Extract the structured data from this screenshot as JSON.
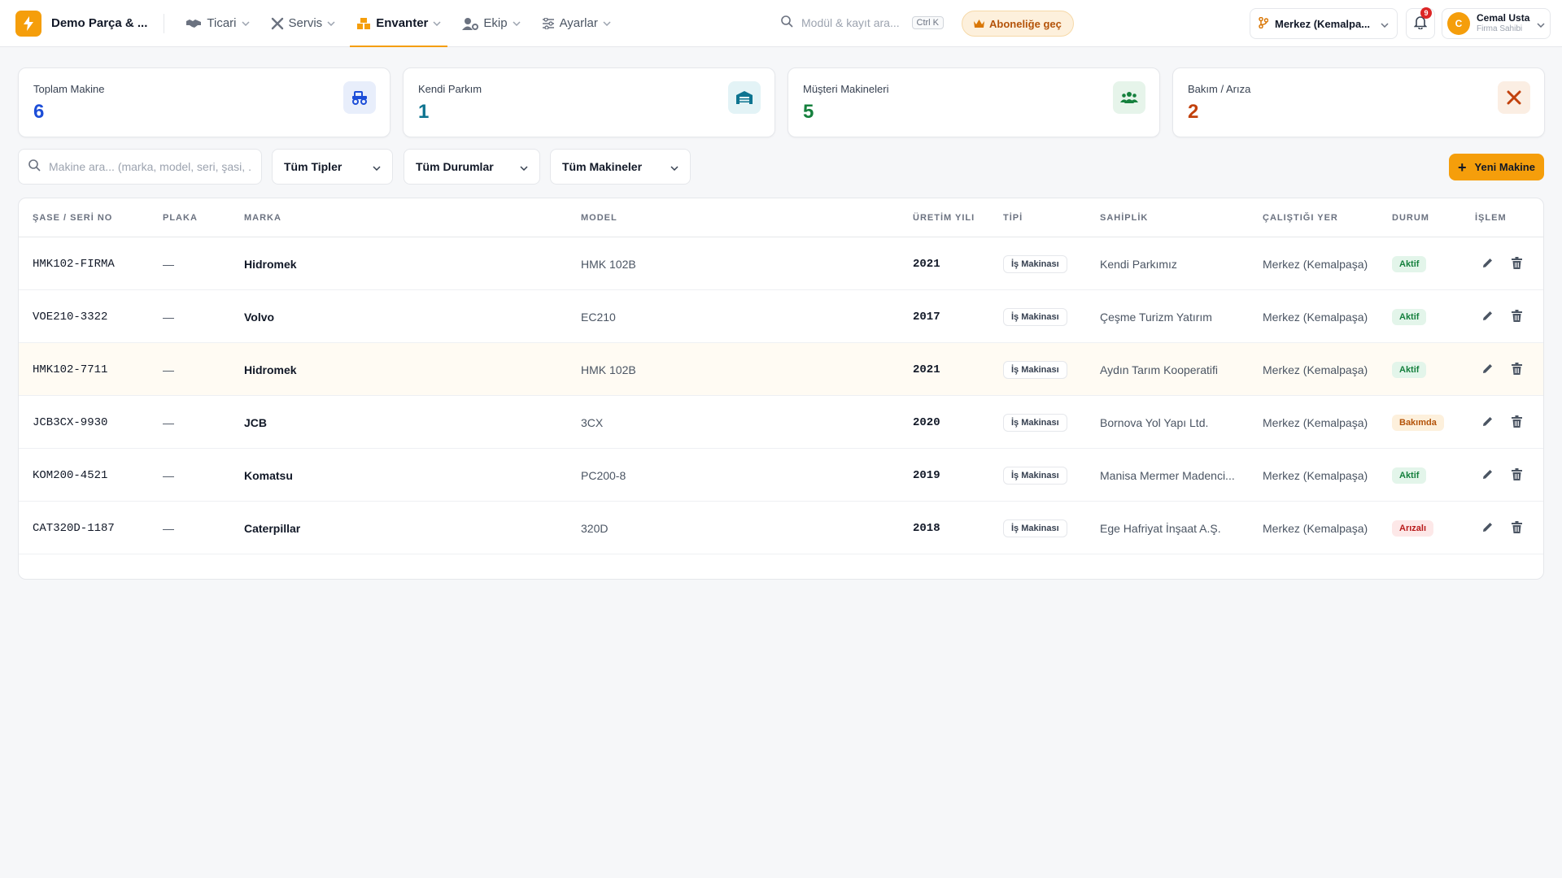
{
  "header": {
    "brand_name": "Demo Parça & ...",
    "nav": [
      {
        "label": "Ticari",
        "icon": "handshake-icon"
      },
      {
        "label": "Servis",
        "icon": "tools-icon"
      },
      {
        "label": "Envanter",
        "icon": "boxes-icon",
        "active": true
      },
      {
        "label": "Ekip",
        "icon": "user-gear-icon"
      },
      {
        "label": "Ayarlar",
        "icon": "sliders-icon"
      }
    ],
    "search_placeholder": "Modül & kayıt ara...",
    "search_shortcut": "Ctrl K",
    "upgrade_label": "Aboneliğe geç",
    "branch_label": "Merkez (Kemalpa...",
    "notification_count": "9",
    "user": {
      "initial": "C",
      "name": "Cemal Usta",
      "role": "Firma Sahibi"
    }
  },
  "stats": [
    {
      "label": "Toplam Makine",
      "value": "6",
      "color": "#1d4ed8",
      "icon": "tractor-icon",
      "icon_bg": "#e8eefb"
    },
    {
      "label": "Kendi Parkım",
      "value": "1",
      "color": "#0e7490",
      "icon": "warehouse-icon",
      "icon_bg": "#e3f3f6"
    },
    {
      "label": "Müşteri Makineleri",
      "value": "5",
      "color": "#15803d",
      "icon": "users-icon",
      "icon_bg": "#e6f4ea"
    },
    {
      "label": "Bakım / Arıza",
      "value": "2",
      "color": "#c2410c",
      "icon": "wrench-screwdriver-icon",
      "icon_bg": "#fbeee3"
    }
  ],
  "filters": {
    "search_placeholder": "Makine ara... (marka, model, seri, şasi, ...",
    "type_select": "Tüm Tipler",
    "status_select": "Tüm Durumlar",
    "machine_select": "Tüm Makineler",
    "new_button": "Yeni Makine"
  },
  "table": {
    "columns": [
      "ŞASE / SERİ NO",
      "PLAKA",
      "MARKA",
      "MODEL",
      "ÜRETİM YILI",
      "TİPİ",
      "SAHİPLİK",
      "ÇALIŞTIĞI YER",
      "DURUM",
      "İŞLEM"
    ],
    "rows": [
      {
        "serial": "HMK102-FIRMA",
        "plate": "—",
        "brand": "Hidromek",
        "model": "HMK 102B",
        "year": "2021",
        "type": "İş Makinası",
        "owner": "Kendi Parkımız",
        "location": "Merkez (Kemalpaşa)",
        "status": "Aktif",
        "status_kind": "active"
      },
      {
        "serial": "VOE210-3322",
        "plate": "—",
        "brand": "Volvo",
        "model": "EC210",
        "year": "2017",
        "type": "İş Makinası",
        "owner": "Çeşme Turizm Yatırım",
        "location": "Merkez (Kemalpaşa)",
        "status": "Aktif",
        "status_kind": "active"
      },
      {
        "serial": "HMK102-7711",
        "plate": "—",
        "brand": "Hidromek",
        "model": "HMK 102B",
        "year": "2021",
        "type": "İş Makinası",
        "owner": "Aydın Tarım Kooperatifi",
        "location": "Merkez (Kemalpaşa)",
        "status": "Aktif",
        "status_kind": "active",
        "highlight": true
      },
      {
        "serial": "JCB3CX-9930",
        "plate": "—",
        "brand": "JCB",
        "model": "3CX",
        "year": "2020",
        "type": "İş Makinası",
        "owner": "Bornova Yol Yapı Ltd.",
        "location": "Merkez (Kemalpaşa)",
        "status": "Bakımda",
        "status_kind": "maintenance"
      },
      {
        "serial": "KOM200-4521",
        "plate": "—",
        "brand": "Komatsu",
        "model": "PC200-8",
        "year": "2019",
        "type": "İş Makinası",
        "owner": "Manisa Mermer Madenci...",
        "location": "Merkez (Kemalpaşa)",
        "status": "Aktif",
        "status_kind": "active"
      },
      {
        "serial": "CAT320D-1187",
        "plate": "—",
        "brand": "Caterpillar",
        "model": "320D",
        "year": "2018",
        "type": "İş Makinası",
        "owner": "Ege Hafriyat İnşaat A.Ş.",
        "location": "Merkez (Kemalpaşa)",
        "status": "Arızalı",
        "status_kind": "fault"
      }
    ]
  },
  "colors": {
    "accent": "#f59e0b",
    "status_active_bg": "#e3f5ea",
    "status_active_fg": "#15803d",
    "status_maintenance_bg": "#fdf0dc",
    "status_maintenance_fg": "#b45309",
    "status_fault_bg": "#fde8e8",
    "status_fault_fg": "#b91c1c"
  }
}
